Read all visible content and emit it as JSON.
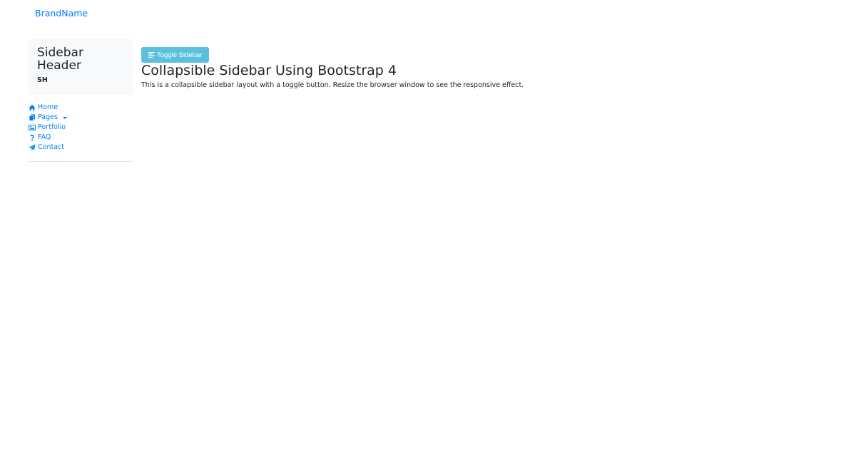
{
  "navbar": {
    "brand": "BrandName"
  },
  "sidebar": {
    "header_title": "Sidebar Header",
    "header_short": "SH",
    "items": [
      {
        "label": "Home",
        "icon": "home-icon"
      },
      {
        "label": "Pages",
        "icon": "pages-icon",
        "has_dropdown": true
      },
      {
        "label": "Portfolio",
        "icon": "image-icon"
      },
      {
        "label": "FAQ",
        "icon": "question-icon"
      },
      {
        "label": "Contact",
        "icon": "paper-plane-icon"
      }
    ]
  },
  "main": {
    "toggle_label": "Toggle Sidebar",
    "toggle_icon": "align-left-icon",
    "title": "Collapsible Sidebar Using Bootstrap 4",
    "description": "This is a collapsible sidebar layout with a toggle button. Resize the browser window to see the responsive effect."
  },
  "colors": {
    "link": "#007bff",
    "button": "#5bc0de",
    "sidebar_header_bg": "#f8f9fa"
  }
}
